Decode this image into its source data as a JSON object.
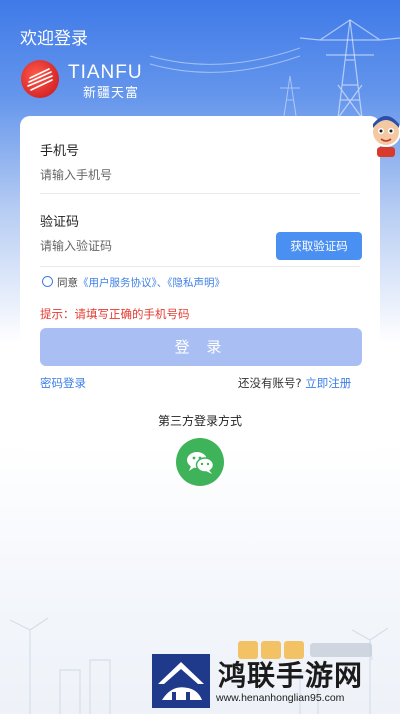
{
  "header": {
    "welcome": "欢迎登录",
    "brand_en": "TIANFU",
    "brand_cn": "新疆天富"
  },
  "form": {
    "phone_label": "手机号",
    "phone_placeholder": "请输入手机号",
    "code_label": "验证码",
    "code_placeholder": "请输入验证码",
    "get_code_label": "获取验证码",
    "agree_prefix": "同意",
    "agreement_link": "《用户服务协议》",
    "separator": "、",
    "privacy_link": "《隐私声明》",
    "hint": "提示：请填写正确的手机号码",
    "login_label": "登 录",
    "password_login": "密码登录",
    "no_account": "还没有账号?",
    "register": "立即注册"
  },
  "third_party": {
    "title": "第三方登录方式",
    "icons": [
      "wechat-icon"
    ]
  },
  "watermark": {
    "text": "鸿联手游网",
    "url": "www.henanhonglian95.com"
  },
  "colors": {
    "primary": "#3f7fe6",
    "login_button_disabled": "#a9bff3",
    "hint_red": "#e33b2f",
    "wechat_green": "#3fb35a"
  }
}
